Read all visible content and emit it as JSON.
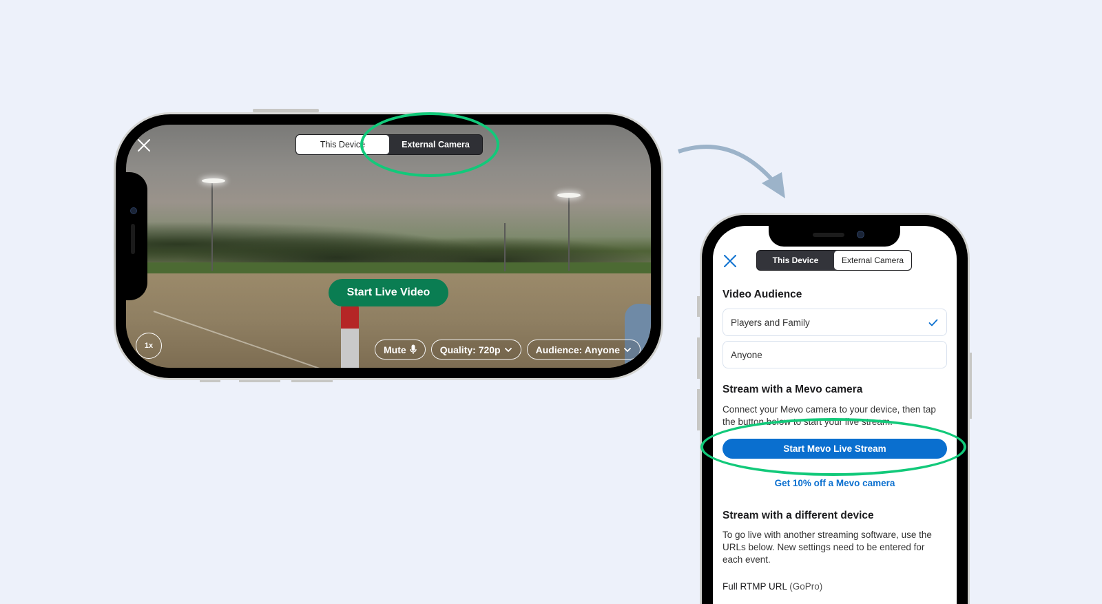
{
  "landscape_screen": {
    "segmented_control": {
      "options": [
        "This Device",
        "External Camera"
      ],
      "selected": "External Camera"
    },
    "start_button": "Start Live Video",
    "zoom_level": "1x",
    "controls": {
      "mute": "Mute",
      "quality": "Quality: 720p",
      "audience": "Audience: Anyone"
    },
    "icons": {
      "close": "close-icon",
      "mic": "microphone-icon",
      "chevron": "chevron-down-icon"
    }
  },
  "portrait_screen": {
    "segmented_control": {
      "options": [
        "This Device",
        "External Camera"
      ],
      "selected": "This Device"
    },
    "video_audience": {
      "heading": "Video Audience",
      "options": [
        {
          "label": "Players and Family",
          "selected": true
        },
        {
          "label": "Anyone",
          "selected": false
        }
      ]
    },
    "mevo": {
      "heading": "Stream with a Mevo camera",
      "description": "Connect your Mevo camera to your device, then tap the button below to start your live stream.",
      "button": "Start Mevo Live Stream",
      "promo_link": "Get 10% off a Mevo camera"
    },
    "different_device": {
      "heading": "Stream with a different device",
      "description": "To go live with another streaming software, use the URLs below. New settings need to be entered for each event.",
      "rtmp_label": "Full RTMP URL",
      "rtmp_hint": "(GoPro)"
    }
  },
  "colors": {
    "background": "#edf1fa",
    "highlight": "#12c97a",
    "start_live_green": "#0a7d52",
    "mevo_blue": "#0a6fcf",
    "arrow": "#9cb3c9"
  }
}
